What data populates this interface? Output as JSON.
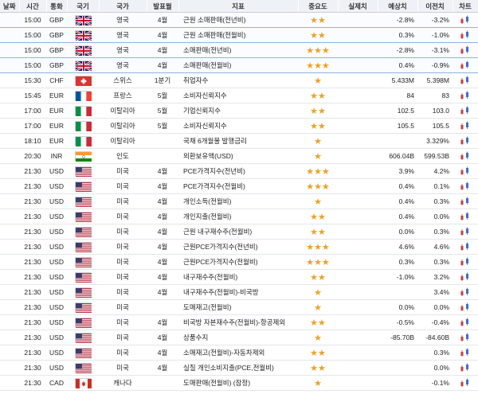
{
  "headers": [
    "날짜",
    "시간",
    "통화",
    "국기",
    "국가",
    "발표월",
    "지표",
    "중요도",
    "실제치",
    "예상치",
    "이전치",
    "차트"
  ],
  "rows": [
    {
      "time": "15:00",
      "cur": "GBP",
      "flag": "gb",
      "country": "영국",
      "month": "4월",
      "indicator": "근원 소매판매(전년비)",
      "stars": 2,
      "actual": "",
      "forecast": "-2.8%",
      "previous": "-3.2%",
      "hl": true
    },
    {
      "time": "15:00",
      "cur": "GBP",
      "flag": "gb",
      "country": "영국",
      "month": "4월",
      "indicator": "근원 소매판매(전월비)",
      "stars": 2,
      "actual": "",
      "forecast": "0.3%",
      "previous": "-1.0%",
      "hl": true
    },
    {
      "time": "15:00",
      "cur": "GBP",
      "flag": "gb",
      "country": "영국",
      "month": "4월",
      "indicator": "소매판매(전년비)",
      "stars": 3,
      "actual": "",
      "forecast": "-2.8%",
      "previous": "-3.1%",
      "hl": true
    },
    {
      "time": "15:00",
      "cur": "GBP",
      "flag": "gb",
      "country": "영국",
      "month": "4월",
      "indicator": "소매판매(전월비)",
      "stars": 3,
      "actual": "",
      "forecast": "0.4%",
      "previous": "-0.9%",
      "hl": true
    },
    {
      "time": "15:30",
      "cur": "CHF",
      "flag": "ch",
      "country": "스위스",
      "month": "1분기",
      "indicator": "취업자수",
      "stars": 1,
      "actual": "",
      "forecast": "5.433M",
      "previous": "5.398M",
      "hl": false
    },
    {
      "time": "15:45",
      "cur": "EUR",
      "flag": "fr",
      "country": "프랑스",
      "month": "5월",
      "indicator": "소비자신뢰지수",
      "stars": 2,
      "actual": "",
      "forecast": "84",
      "previous": "83",
      "hl": false
    },
    {
      "time": "17:00",
      "cur": "EUR",
      "flag": "it",
      "country": "이탈리아",
      "month": "5월",
      "indicator": "기업신뢰지수",
      "stars": 2,
      "actual": "",
      "forecast": "102.5",
      "previous": "103.0",
      "hl": false
    },
    {
      "time": "17:00",
      "cur": "EUR",
      "flag": "it",
      "country": "이탈리아",
      "month": "5월",
      "indicator": "소비자신뢰지수",
      "stars": 2,
      "actual": "",
      "forecast": "105.5",
      "previous": "105.5",
      "hl": false
    },
    {
      "time": "18:10",
      "cur": "EUR",
      "flag": "it",
      "country": "이탈리아",
      "month": "",
      "indicator": "국채 6개월물 발행금리",
      "stars": 1,
      "actual": "",
      "forecast": "",
      "previous": "3.329%",
      "hl": false
    },
    {
      "time": "20:30",
      "cur": "INR",
      "flag": "in",
      "country": "인도",
      "month": "",
      "indicator": "외환보유액(USD)",
      "stars": 1,
      "actual": "",
      "forecast": "606.04B",
      "previous": "599.53B",
      "hl": false
    },
    {
      "time": "21:30",
      "cur": "USD",
      "flag": "us",
      "country": "미국",
      "month": "4월",
      "indicator": "PCE가격지수(전년비)",
      "stars": 3,
      "actual": "",
      "forecast": "3.9%",
      "previous": "4.2%",
      "hl": false
    },
    {
      "time": "21:30",
      "cur": "USD",
      "flag": "us",
      "country": "미국",
      "month": "4월",
      "indicator": "PCE가격지수(전월비)",
      "stars": 3,
      "actual": "",
      "forecast": "0.4%",
      "previous": "0.1%",
      "hl": false
    },
    {
      "time": "21:30",
      "cur": "USD",
      "flag": "us",
      "country": "미국",
      "month": "4월",
      "indicator": "개인소득(전월비)",
      "stars": 1,
      "actual": "",
      "forecast": "0.4%",
      "previous": "0.3%",
      "hl": false
    },
    {
      "time": "21:30",
      "cur": "USD",
      "flag": "us",
      "country": "미국",
      "month": "4월",
      "indicator": "개인지출(전월비)",
      "stars": 2,
      "actual": "",
      "forecast": "0.4%",
      "previous": "0.0%",
      "hl": false
    },
    {
      "time": "21:30",
      "cur": "USD",
      "flag": "us",
      "country": "미국",
      "month": "4월",
      "indicator": "근원 내구재수주(전월비)",
      "stars": 2,
      "actual": "",
      "forecast": "0.0%",
      "previous": "0.3%",
      "hl": false
    },
    {
      "time": "21:30",
      "cur": "USD",
      "flag": "us",
      "country": "미국",
      "month": "4월",
      "indicator": "근원PCE가격지수(전년비)",
      "stars": 3,
      "actual": "",
      "forecast": "4.6%",
      "previous": "4.6%",
      "hl": false
    },
    {
      "time": "21:30",
      "cur": "USD",
      "flag": "us",
      "country": "미국",
      "month": "4월",
      "indicator": "근원PCE가격지수(전월비)",
      "stars": 3,
      "actual": "",
      "forecast": "0.3%",
      "previous": "0.3%",
      "hl": false
    },
    {
      "time": "21:30",
      "cur": "USD",
      "flag": "us",
      "country": "미국",
      "month": "4월",
      "indicator": "내구재수주(전월비)",
      "stars": 2,
      "actual": "",
      "forecast": "-1.0%",
      "previous": "3.2%",
      "hl": false
    },
    {
      "time": "21:30",
      "cur": "USD",
      "flag": "us",
      "country": "미국",
      "month": "4월",
      "indicator": "내구재수주(전월비)-비국방",
      "stars": 1,
      "actual": "",
      "forecast": "",
      "previous": "3.4%",
      "hl": false
    },
    {
      "time": "21:30",
      "cur": "USD",
      "flag": "us",
      "country": "미국",
      "month": "",
      "indicator": "도매재고(전월비)",
      "stars": 1,
      "actual": "",
      "forecast": "0.0%",
      "previous": "0.0%",
      "hl": false
    },
    {
      "time": "21:30",
      "cur": "USD",
      "flag": "us",
      "country": "미국",
      "month": "4월",
      "indicator": "비국방 자본재수주(전월비)-항공제외",
      "stars": 2,
      "actual": "",
      "forecast": "-0.5%",
      "previous": "-0.4%",
      "hl": false
    },
    {
      "time": "21:30",
      "cur": "USD",
      "flag": "us",
      "country": "미국",
      "month": "4월",
      "indicator": "상품수지",
      "stars": 1,
      "actual": "",
      "forecast": "-85.70B",
      "previous": "-84.60B",
      "hl": false
    },
    {
      "time": "21:30",
      "cur": "USD",
      "flag": "us",
      "country": "미국",
      "month": "4월",
      "indicator": "소매재고(전월비)-자동차제외",
      "stars": 2,
      "actual": "",
      "forecast": "",
      "previous": "0.3%",
      "hl": false
    },
    {
      "time": "21:30",
      "cur": "USD",
      "flag": "us",
      "country": "미국",
      "month": "4월",
      "indicator": "실질 개인소비지출(PCE,전월비)",
      "stars": 2,
      "actual": "",
      "forecast": "",
      "previous": "0.0%",
      "hl": false
    },
    {
      "time": "21:30",
      "cur": "CAD",
      "flag": "ca",
      "country": "캐나다",
      "month": "",
      "indicator": "도매판매(전월비) (잠정)",
      "stars": 1,
      "actual": "",
      "forecast": "",
      "previous": "-0.1%",
      "hl": false
    }
  ]
}
